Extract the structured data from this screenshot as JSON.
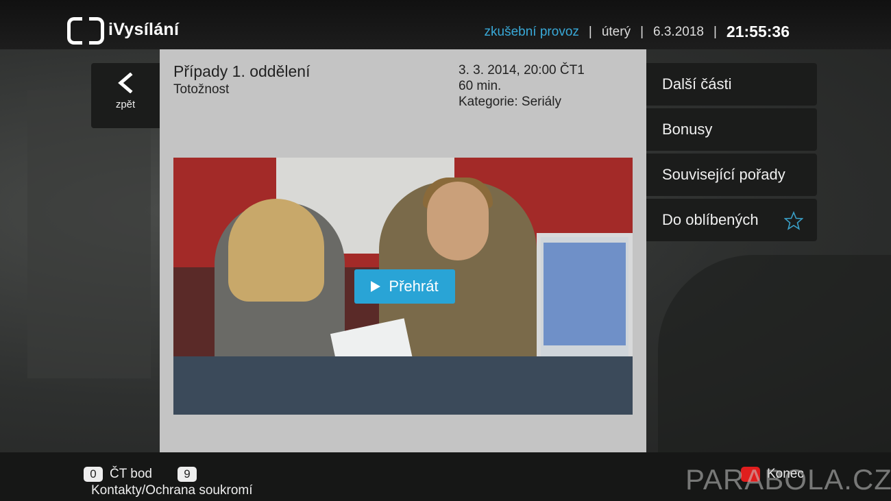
{
  "header": {
    "logo_text": "iVysílání",
    "trial_text": "zkušební provoz",
    "day": "úterý",
    "date": "6.3.2018",
    "time": "21:55:36",
    "separator": "|"
  },
  "back": {
    "label": "zpět"
  },
  "detail": {
    "title": "Případy 1. oddělení",
    "subtitle": "Totožnost",
    "meta": [
      "3. 3. 2014, 20:00 ČT1",
      "60 min.",
      "Kategorie: Seriály"
    ],
    "play_label": "Přehrát"
  },
  "menu": {
    "items": [
      "Další části",
      "Bonusy",
      "Související pořady",
      "Do oblíbených"
    ]
  },
  "footer": {
    "key0": "0",
    "key0_label": "ČT bod",
    "key9": "9",
    "contacts": "Kontakty/Ochrana soukromí",
    "exit_label": "Konec"
  },
  "watermark": "PARABOLA.CZ",
  "colors": {
    "accent_blue": "#29a4d6",
    "trial_text": "#39a9d8",
    "exit_red": "#e01e1e",
    "panel_bg": "#c4c4c4"
  }
}
